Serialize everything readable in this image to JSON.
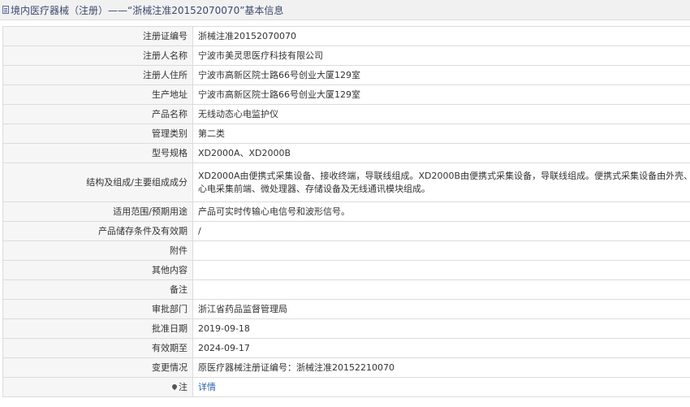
{
  "header": {
    "title": "境内医疗器械（注册）——“浙械注准20152070070”基本信息",
    "icon": "document-icon"
  },
  "rows": [
    {
      "label": "注册证编号",
      "value": "浙械注准20152070070"
    },
    {
      "label": "注册人名称",
      "value": "宁波市美灵思医疗科技有限公司"
    },
    {
      "label": "注册人住所",
      "value": "宁波市高新区院士路66号创业大厦129室"
    },
    {
      "label": "生产地址",
      "value": "宁波市高新区院士路66号创业大厦129室"
    },
    {
      "label": "产品名称",
      "value": "无线动态心电监护仪"
    },
    {
      "label": "管理类别",
      "value": "第二类"
    },
    {
      "label": "型号规格",
      "value": "XD2000A、XD2000B"
    },
    {
      "label": "结构及组成/主要组成成分",
      "value": "XD2000A由便携式采集设备、接收终端，导联线组成。XD2000B由便携式采集设备，导联线组成。便携式采集设备由外壳、心电采集前端、微处理器、存储设备及无线通讯模块组成。"
    },
    {
      "label": "适用范围/预期用途",
      "value": "产品可实时传输心电信号和波形信号。"
    },
    {
      "label": "产品储存条件及有效期",
      "value": "/"
    },
    {
      "label": "附件",
      "value": ""
    },
    {
      "label": "其他内容",
      "value": ""
    },
    {
      "label": "备注",
      "value": ""
    },
    {
      "label": "审批部门",
      "value": "浙江省药品监督管理局"
    },
    {
      "label": "批准日期",
      "value": "2019-09-18"
    },
    {
      "label": "有效期至",
      "value": "2024-09-17"
    },
    {
      "label": "变更情况",
      "value": "原医疗器械注册证编号：浙械注准20152210070"
    }
  ],
  "note": {
    "label": "注",
    "icon": "pin-icon",
    "link": "详情"
  }
}
